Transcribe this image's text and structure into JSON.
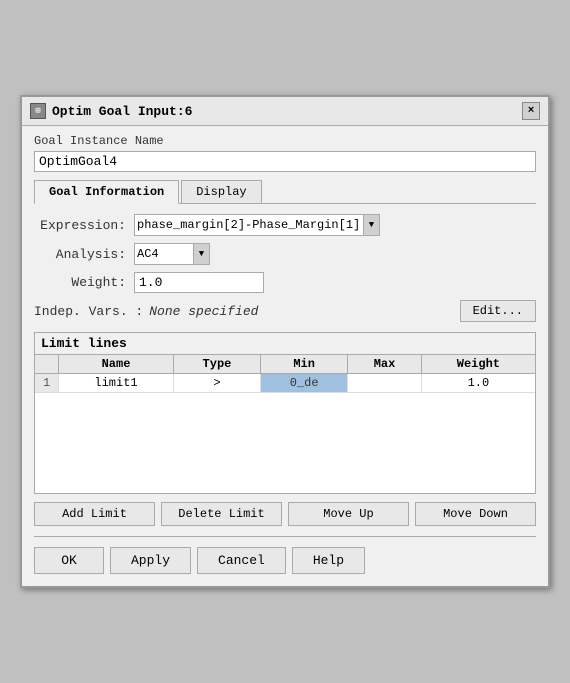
{
  "window": {
    "title": "Optim Goal Input:6",
    "icon": "⊞",
    "close_label": "×"
  },
  "goal_instance": {
    "label": "Goal Instance Name",
    "value": "OptimGoal4"
  },
  "tabs": [
    {
      "id": "goal-info",
      "label": "Goal Information",
      "active": true
    },
    {
      "id": "display",
      "label": "Display",
      "active": false
    }
  ],
  "form": {
    "expression_label": "Expression:",
    "expression_value": "phase_margin[2]-Phase_Margin[1]",
    "analysis_label": "Analysis:",
    "analysis_value": "AC4",
    "weight_label": "Weight:",
    "weight_value": "1.0",
    "indep_vars_label": "Indep. Vars. :",
    "indep_vars_value": "None specified",
    "edit_label": "Edit..."
  },
  "limit_lines": {
    "section_title": "Limit lines",
    "columns": [
      "Name",
      "Type",
      "Min",
      "Max",
      "Weight"
    ],
    "rows": [
      {
        "num": "1",
        "name": "limit1",
        "type": ">",
        "min": "0_de",
        "max": "",
        "weight": "1.0"
      }
    ]
  },
  "action_buttons": {
    "add_limit": "Add Limit",
    "delete_limit": "Delete Limit",
    "move_up": "Move Up",
    "move_down": "Move Down"
  },
  "bottom_buttons": {
    "ok": "OK",
    "apply": "Apply",
    "cancel": "Cancel",
    "help": "Help"
  }
}
